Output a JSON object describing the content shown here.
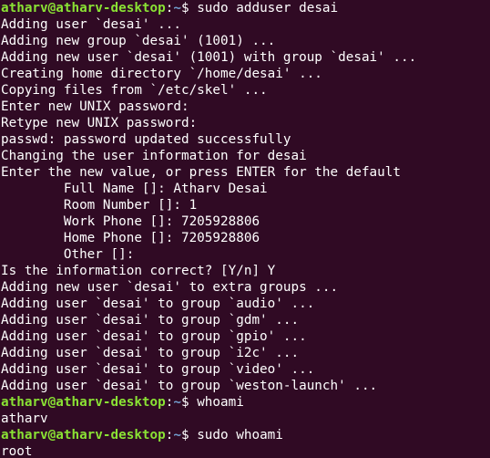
{
  "window": {
    "app": "terminal"
  },
  "prompt": {
    "user_host": "atharv@atharv-desktop",
    "colon": ":",
    "path": "~",
    "dollar": "$ "
  },
  "commands": {
    "adduser": "sudo adduser desai",
    "whoami": "whoami",
    "sudo_whoami": "sudo whoami"
  },
  "output": {
    "adduser_lines": [
      "Adding user `desai' ...",
      "Adding new group `desai' (1001) ...",
      "Adding new user `desai' (1001) with group `desai' ...",
      "Creating home directory `/home/desai' ...",
      "Copying files from `/etc/skel' ...",
      "Enter new UNIX password:",
      "Retype new UNIX password:",
      "passwd: password updated successfully",
      "Changing the user information for desai",
      "Enter the new value, or press ENTER for the default",
      "        Full Name []: Atharv Desai",
      "        Room Number []: 1",
      "        Work Phone []: 7205928806",
      "        Home Phone []: 7205928806",
      "        Other []:",
      "Is the information correct? [Y/n] Y",
      "Adding new user `desai' to extra groups ...",
      "Adding user `desai' to group `audio' ...",
      "Adding user `desai' to group `gdm' ...",
      "Adding user `desai' to group `gpio' ...",
      "Adding user `desai' to group `i2c' ...",
      "Adding user `desai' to group `video' ...",
      "Adding user `desai' to group `weston-launch' ..."
    ],
    "whoami_result": "atharv",
    "sudo_whoami_result": "root"
  },
  "colors": {
    "background": "#300a24",
    "text": "#ffffff",
    "prompt_user": "#8ae234",
    "prompt_path": "#729fcf"
  }
}
